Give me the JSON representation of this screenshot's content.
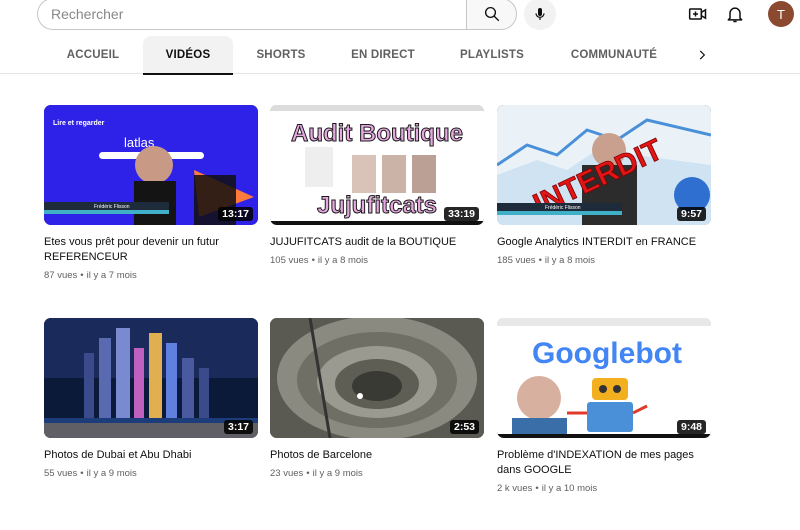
{
  "search": {
    "placeholder": "Rechercher",
    "value": ""
  },
  "header": {
    "avatar_letter": "T"
  },
  "icons": {
    "search": "search-icon",
    "mic": "microphone-icon",
    "create": "create-video-icon",
    "notifications": "bell-icon",
    "next": "chevron-right-icon"
  },
  "tabs": [
    {
      "label": "ACCUEIL",
      "active": false
    },
    {
      "label": "VIDÉOS",
      "active": true
    },
    {
      "label": "SHORTS",
      "active": false
    },
    {
      "label": "EN DIRECT",
      "active": false
    },
    {
      "label": "PLAYLISTS",
      "active": false
    },
    {
      "label": "COMMUNAUTÉ",
      "active": false
    }
  ],
  "videos": [
    {
      "title": "Etes vous prêt pour devenir un futur REFERENCEUR",
      "views": "87 vues",
      "age": "il y a 7 mois",
      "duration": "13:17",
      "thumb_text": {
        "top": "Lire et regarder",
        "logo": "latlas",
        "caption": "Frédéric Flisson"
      }
    },
    {
      "title": "JUJUFITCATS audit de la BOUTIQUE",
      "views": "105 vues",
      "age": "il y a 8 mois",
      "duration": "33:19",
      "thumb_text": {
        "top": "Audit Boutique",
        "bottom": "Jujufitcats"
      }
    },
    {
      "title": "Google Analytics INTERDIT en FRANCE",
      "views": "185 vues",
      "age": "il y a 8 mois",
      "duration": "9:57",
      "thumb_text": {
        "stamp": "INTERDIT",
        "caption": "Frédéric Flisson"
      }
    },
    {
      "title": "Photos de Dubai et Abu Dhabi",
      "views": "55 vues",
      "age": "il y a 9 mois",
      "duration": "3:17"
    },
    {
      "title": "Photos de Barcelone",
      "views": "23 vues",
      "age": "il y a 9 mois",
      "duration": "2:53"
    },
    {
      "title": "Problème d'INDEXATION de mes pages dans GOOGLE",
      "views": "2 k vues",
      "age": "il y a 10 mois",
      "duration": "9:48",
      "thumb_text": {
        "logo": "Googlebot"
      }
    }
  ]
}
